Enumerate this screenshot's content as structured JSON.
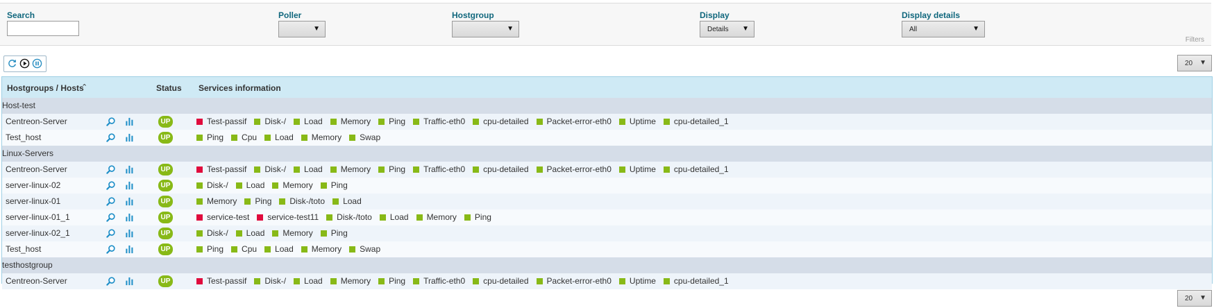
{
  "filters": {
    "search_label": "Search",
    "search_value": "",
    "poller_label": "Poller",
    "poller_value": "",
    "hostgroup_label": "Hostgroup",
    "hostgroup_value": "",
    "display_label": "Display",
    "display_value": "Details",
    "display_details_label": "Display details",
    "display_details_value": "All",
    "filters_tag": "Filters"
  },
  "toolbar": {
    "icons": [
      "refresh-icon",
      "play-icon",
      "pause-icon"
    ],
    "per_page": "20"
  },
  "table": {
    "col_hosts": "Hostgroups / Hosts",
    "col_status": "Status",
    "col_services": "Services information",
    "groups": [
      {
        "name": "Host-test",
        "hosts": [
          {
            "name": "Centreon-Server",
            "status": "UP",
            "services": [
              {
                "name": "Test-passif",
                "state": "crit"
              },
              {
                "name": "Disk-/",
                "state": "ok"
              },
              {
                "name": "Load",
                "state": "ok"
              },
              {
                "name": "Memory",
                "state": "ok"
              },
              {
                "name": "Ping",
                "state": "ok"
              },
              {
                "name": "Traffic-eth0",
                "state": "ok"
              },
              {
                "name": "cpu-detailed",
                "state": "ok"
              },
              {
                "name": "Packet-error-eth0",
                "state": "ok"
              },
              {
                "name": "Uptime",
                "state": "ok"
              },
              {
                "name": "cpu-detailed_1",
                "state": "ok"
              }
            ]
          },
          {
            "name": "Test_host",
            "status": "UP",
            "services": [
              {
                "name": "Ping",
                "state": "ok"
              },
              {
                "name": "Cpu",
                "state": "ok"
              },
              {
                "name": "Load",
                "state": "ok"
              },
              {
                "name": "Memory",
                "state": "ok"
              },
              {
                "name": "Swap",
                "state": "ok"
              }
            ]
          }
        ]
      },
      {
        "name": "Linux-Servers",
        "hosts": [
          {
            "name": "Centreon-Server",
            "status": "UP",
            "services": [
              {
                "name": "Test-passif",
                "state": "crit"
              },
              {
                "name": "Disk-/",
                "state": "ok"
              },
              {
                "name": "Load",
                "state": "ok"
              },
              {
                "name": "Memory",
                "state": "ok"
              },
              {
                "name": "Ping",
                "state": "ok"
              },
              {
                "name": "Traffic-eth0",
                "state": "ok"
              },
              {
                "name": "cpu-detailed",
                "state": "ok"
              },
              {
                "name": "Packet-error-eth0",
                "state": "ok"
              },
              {
                "name": "Uptime",
                "state": "ok"
              },
              {
                "name": "cpu-detailed_1",
                "state": "ok"
              }
            ]
          },
          {
            "name": "server-linux-02",
            "status": "UP",
            "services": [
              {
                "name": "Disk-/",
                "state": "ok"
              },
              {
                "name": "Load",
                "state": "ok"
              },
              {
                "name": "Memory",
                "state": "ok"
              },
              {
                "name": "Ping",
                "state": "ok"
              }
            ]
          },
          {
            "name": "server-linux-01",
            "status": "UP",
            "services": [
              {
                "name": "Memory",
                "state": "ok"
              },
              {
                "name": "Ping",
                "state": "ok"
              },
              {
                "name": "Disk-/toto",
                "state": "ok"
              },
              {
                "name": "Load",
                "state": "ok"
              }
            ]
          },
          {
            "name": "server-linux-01_1",
            "status": "UP",
            "services": [
              {
                "name": "service-test",
                "state": "crit"
              },
              {
                "name": "service-test11",
                "state": "crit"
              },
              {
                "name": "Disk-/toto",
                "state": "ok"
              },
              {
                "name": "Load",
                "state": "ok"
              },
              {
                "name": "Memory",
                "state": "ok"
              },
              {
                "name": "Ping",
                "state": "ok"
              }
            ]
          },
          {
            "name": "server-linux-02_1",
            "status": "UP",
            "services": [
              {
                "name": "Disk-/",
                "state": "ok"
              },
              {
                "name": "Load",
                "state": "ok"
              },
              {
                "name": "Memory",
                "state": "ok"
              },
              {
                "name": "Ping",
                "state": "ok"
              }
            ]
          },
          {
            "name": "Test_host",
            "status": "UP",
            "services": [
              {
                "name": "Ping",
                "state": "ok"
              },
              {
                "name": "Cpu",
                "state": "ok"
              },
              {
                "name": "Load",
                "state": "ok"
              },
              {
                "name": "Memory",
                "state": "ok"
              },
              {
                "name": "Swap",
                "state": "ok"
              }
            ]
          }
        ]
      },
      {
        "name": "testhostgroup",
        "hosts": [
          {
            "name": "Centreon-Server",
            "status": "UP",
            "services": [
              {
                "name": "Test-passif",
                "state": "crit"
              },
              {
                "name": "Disk-/",
                "state": "ok"
              },
              {
                "name": "Load",
                "state": "ok"
              },
              {
                "name": "Memory",
                "state": "ok"
              },
              {
                "name": "Ping",
                "state": "ok"
              },
              {
                "name": "Traffic-eth0",
                "state": "ok"
              },
              {
                "name": "cpu-detailed",
                "state": "ok"
              },
              {
                "name": "Packet-error-eth0",
                "state": "ok"
              },
              {
                "name": "Uptime",
                "state": "ok"
              },
              {
                "name": "cpu-detailed_1",
                "state": "ok"
              }
            ]
          }
        ]
      }
    ]
  },
  "colors": {
    "ok": "#88b917",
    "critical": "#e00b3d",
    "accent": "#10677d",
    "header_bg": "#cfeaf5"
  }
}
